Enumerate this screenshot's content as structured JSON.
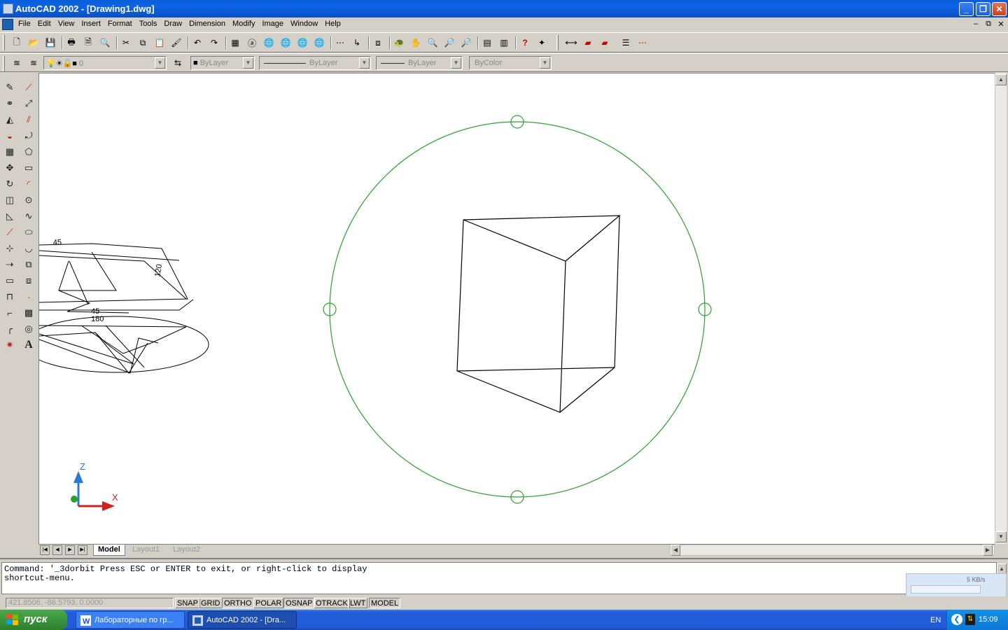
{
  "window": {
    "title": "AutoCAD 2002 - [Drawing1.dwg]",
    "controls": [
      "_",
      "❐",
      "✕"
    ]
  },
  "menubar": {
    "items": [
      "File",
      "Edit",
      "View",
      "Insert",
      "Format",
      "Tools",
      "Draw",
      "Dimension",
      "Modify",
      "Image",
      "Window",
      "Help"
    ],
    "mdi_controls": [
      "–",
      "⧉",
      "✕"
    ]
  },
  "layers_toolbar": {
    "layer_value": "0",
    "color_value": "ByLayer",
    "linetype_value": "ByLayer",
    "lineweight_value": "ByLayer",
    "plotstyle_value": "ByColor"
  },
  "drawing": {
    "ucs_labels": {
      "z": "Z",
      "x": "X"
    },
    "dim_labels": [
      "45",
      "120",
      "45",
      "180"
    ],
    "colors": {
      "orbit": "#2ca02c",
      "geometry": "#000000",
      "ucs_z": "#2a78d8",
      "ucs_x": "#d02020"
    }
  },
  "tabs": {
    "items": [
      "Model",
      "Layout1",
      "Layout2"
    ],
    "active": "Model"
  },
  "command": {
    "line1": "Command: '_3dorbit Press ESC or ENTER to exit, or right-click to display",
    "line2": "shortcut-menu."
  },
  "network_monitor": {
    "rate": "5 KB/s"
  },
  "statusbar": {
    "coordinates": "421.8506, -86.5793, 0.0000",
    "toggles": [
      "SNAP",
      "GRID",
      "ORTHO",
      "POLAR",
      "OSNAP",
      "OTRACK",
      "LWT",
      "MODEL"
    ]
  },
  "taskbar": {
    "start_label": "пуск",
    "tasks": [
      "Лабораторные по гр...",
      "AutoCAD 2002 - [Dra..."
    ],
    "language": "EN",
    "clock": "15:09"
  }
}
